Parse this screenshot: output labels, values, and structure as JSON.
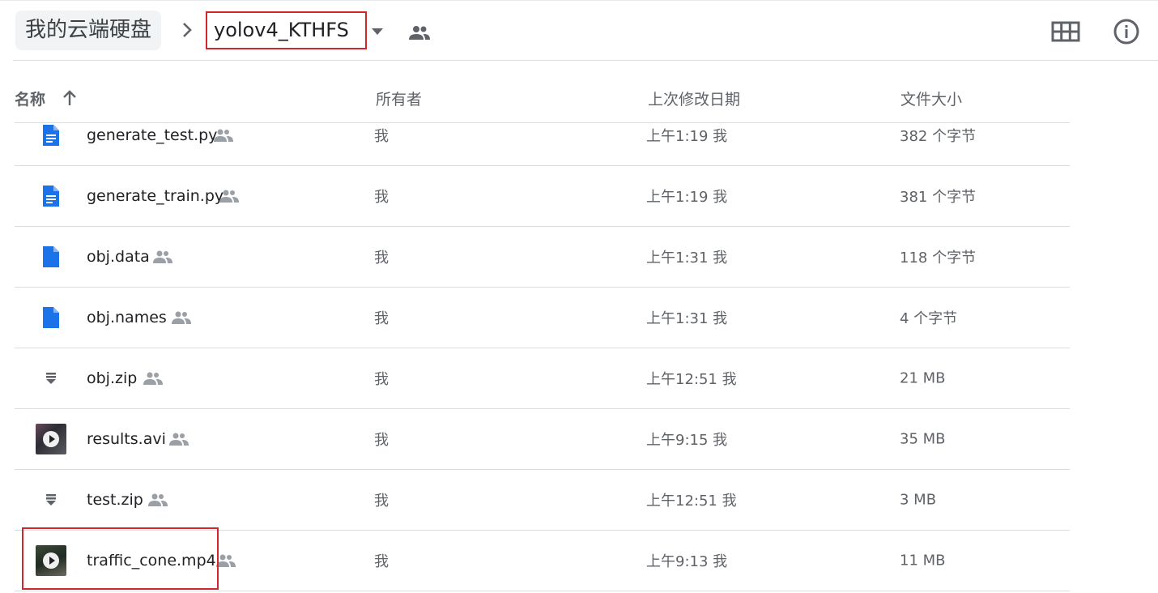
{
  "breadcrumb": {
    "root": "我的云端硬盘",
    "current": "yolov4_KTHFS"
  },
  "columns": {
    "name": "名称",
    "owner": "所有者",
    "modified": "上次修改日期",
    "size": "文件大小"
  },
  "files": [
    {
      "name": "generate_test.py",
      "owner": "我",
      "modified": "上午1:19 我",
      "size": "382 个字节",
      "type": "doc",
      "icon": "doc-icon"
    },
    {
      "name": "generate_train.py",
      "owner": "我",
      "modified": "上午1:19 我",
      "size": "381 个字节",
      "type": "doc",
      "icon": "doc-icon"
    },
    {
      "name": "obj.data",
      "owner": "我",
      "modified": "上午1:31 我",
      "size": "118 个字节",
      "type": "file",
      "icon": "file-icon"
    },
    {
      "name": "obj.names",
      "owner": "我",
      "modified": "上午1:31 我",
      "size": "4 个字节",
      "type": "file",
      "icon": "file-icon"
    },
    {
      "name": "obj.zip",
      "owner": "我",
      "modified": "上午12:51 我",
      "size": "21 MB",
      "type": "zip",
      "icon": "archive-icon"
    },
    {
      "name": "results.avi",
      "owner": "我",
      "modified": "上午9:15 我",
      "size": "35 MB",
      "type": "video",
      "icon": "video-thumbnail"
    },
    {
      "name": "test.zip",
      "owner": "我",
      "modified": "上午12:51 我",
      "size": "3 MB",
      "type": "zip",
      "icon": "archive-icon"
    },
    {
      "name": "traffic_cone.mp4",
      "owner": "我",
      "modified": "上午9:13 我",
      "size": "11 MB",
      "type": "video",
      "icon": "video-thumbnail"
    }
  ],
  "colors": {
    "accent_blue": "#1a73e8",
    "highlight_red": "#d0272c",
    "muted_text": "#5f6368",
    "divider": "#dadce0"
  }
}
